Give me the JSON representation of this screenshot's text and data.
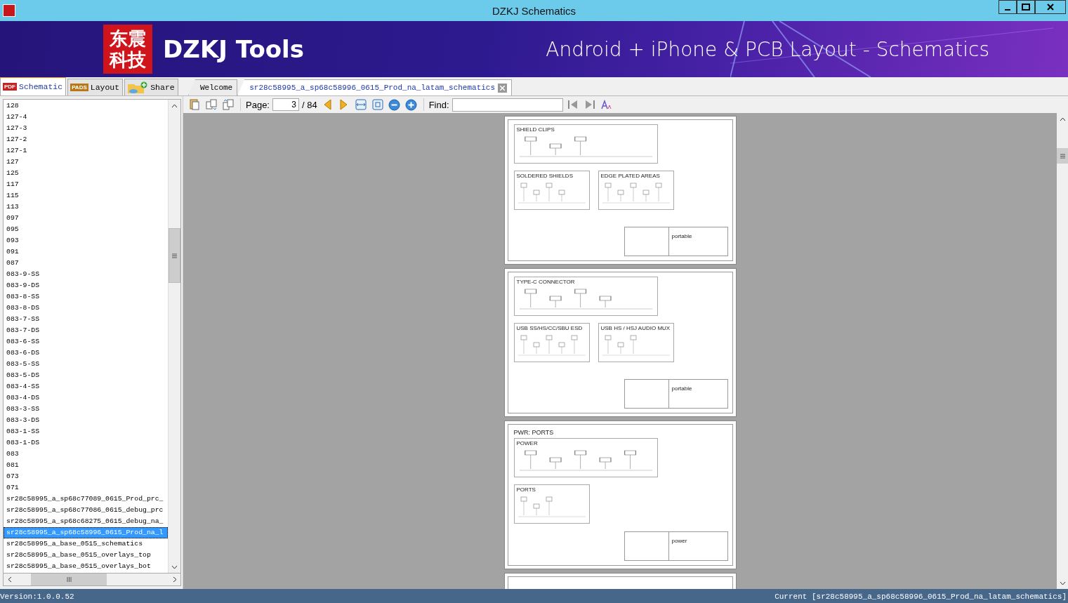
{
  "window": {
    "title": "DZKJ Schematics"
  },
  "banner": {
    "logo_lines": [
      "东震",
      "科技"
    ],
    "brand": "DZKJ Tools",
    "tagline": "Android + iPhone & PCB Layout - Schematics"
  },
  "side_tabs": [
    {
      "label": "Schematic",
      "badge": "PDF",
      "selected": true
    },
    {
      "label": "Layout",
      "badge": "PADS",
      "selected": false
    },
    {
      "label": "Share",
      "selected": false
    }
  ],
  "doc_tabs": [
    {
      "label": "Welcome",
      "selected": false,
      "closable": false
    },
    {
      "label": "sr28c58995_a_sp68c58996_0615_Prod_na_latam_schematics",
      "selected": true,
      "closable": true
    }
  ],
  "toolbar": {
    "page_label": "Page:",
    "page_value": "3",
    "page_total": "/ 84",
    "find_label": "Find:"
  },
  "list": {
    "items": [
      {
        "label": "128",
        "selected": false
      },
      {
        "label": "127-4",
        "selected": false
      },
      {
        "label": "127-3",
        "selected": false
      },
      {
        "label": "127-2",
        "selected": false
      },
      {
        "label": "127-1",
        "selected": false
      },
      {
        "label": "127",
        "selected": false
      },
      {
        "label": "125",
        "selected": false
      },
      {
        "label": "117",
        "selected": false
      },
      {
        "label": "115",
        "selected": false
      },
      {
        "label": "113",
        "selected": false
      },
      {
        "label": "097",
        "selected": false
      },
      {
        "label": "095",
        "selected": false
      },
      {
        "label": "093",
        "selected": false
      },
      {
        "label": "091",
        "selected": false
      },
      {
        "label": "087",
        "selected": false
      },
      {
        "label": "083-9-SS",
        "selected": false
      },
      {
        "label": "083-9-DS",
        "selected": false
      },
      {
        "label": "083-8-SS",
        "selected": false
      },
      {
        "label": "083-8-DS",
        "selected": false
      },
      {
        "label": "083-7-SS",
        "selected": false
      },
      {
        "label": "083-7-DS",
        "selected": false
      },
      {
        "label": "083-6-SS",
        "selected": false
      },
      {
        "label": "083-6-DS",
        "selected": false
      },
      {
        "label": "083-5-SS",
        "selected": false
      },
      {
        "label": "083-5-DS",
        "selected": false
      },
      {
        "label": "083-4-SS",
        "selected": false
      },
      {
        "label": "083-4-DS",
        "selected": false
      },
      {
        "label": "083-3-SS",
        "selected": false
      },
      {
        "label": "083-3-DS",
        "selected": false
      },
      {
        "label": "083-1-SS",
        "selected": false
      },
      {
        "label": "083-1-DS",
        "selected": false
      },
      {
        "label": "083",
        "selected": false
      },
      {
        "label": "081",
        "selected": false
      },
      {
        "label": "073",
        "selected": false
      },
      {
        "label": "071",
        "selected": false
      },
      {
        "label": "sr28c58995_a_sp68c77089_0615_Prod_prc_",
        "selected": false
      },
      {
        "label": "sr28c58995_a_sp68c77086_0615_debug_prc",
        "selected": false
      },
      {
        "label": "sr28c58995_a_sp68c68275_0615_debug_na_",
        "selected": false
      },
      {
        "label": "sr28c58995_a_sp68c58996_0615_Prod_na_l",
        "selected": true
      },
      {
        "label": "sr28c58995_a_base_0515_schematics",
        "selected": false
      },
      {
        "label": "sr28c58995_a_base_0515_overlays_top",
        "selected": false
      },
      {
        "label": "sr28c58995_a_base_0515_overlays_bot",
        "selected": false
      }
    ]
  },
  "pages": [
    {
      "sections": [
        {
          "title": "SHIELD CLIPS"
        },
        {
          "title": "SOLDERED SHIELDS"
        },
        {
          "title": "EDGE PLATED AREAS"
        }
      ],
      "title_block": "portable"
    },
    {
      "sections": [
        {
          "title": "TYPE-C CONNECTOR"
        },
        {
          "title": "USB SS/HS/CC/SBU ESD"
        },
        {
          "title": "USB HS / HSJ AUDIO MUX"
        }
      ],
      "title_block": "portable"
    },
    {
      "heading": "PWR: PORTS",
      "sections": [
        {
          "title": "POWER"
        },
        {
          "title": "PORTS"
        }
      ],
      "title_block": "power"
    }
  ],
  "status_bar": {
    "version": "Version:1.0.0.52",
    "current": "Current [sr28c58995_a_sp68c58996_0615_Prod_na_latam_schematics]"
  }
}
